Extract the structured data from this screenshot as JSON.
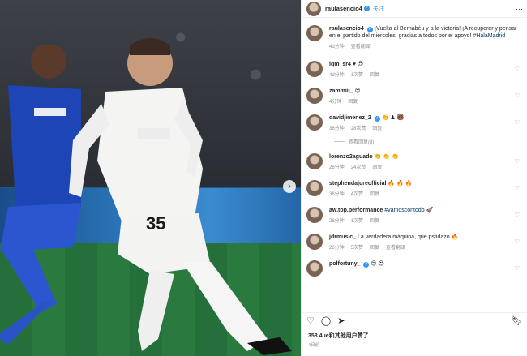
{
  "post_header": {
    "username": "raulasencio4",
    "follow_label": "关注",
    "more_icon": "more-horizontal-icon"
  },
  "caption": {
    "username": "raulasencio4",
    "text": "¡Vuelta al Bernabéu y a la victoria! ¡A recuperar y pensar en el partido del miércoles, gracias a todos por el apoyo!",
    "hashtag": "#HalaMadrid",
    "time": "4d分钟",
    "translate": "查看翻译"
  },
  "comments": [
    {
      "username": "iqm_sr4",
      "text": "♥ 😍",
      "time": "4d分钟",
      "likes": "1次赞",
      "reply": "回复"
    },
    {
      "username": "zammiii_",
      "text": "😍",
      "time": "4分钟",
      "likes": "",
      "reply": "回复"
    },
    {
      "username": "davidjimenez_2",
      "text": "👏 ♟ 🐻",
      "time": "36分钟",
      "likes": "28次赞",
      "reply": "回复"
    },
    {
      "username": "lorenzo2aguado",
      "text": "👏 👏 👏",
      "time": "26分钟",
      "likes": "24次赞",
      "reply": "回复"
    },
    {
      "username": "stephendajureofficial",
      "text": "🔥 🔥 🔥",
      "time": "36分钟",
      "likes": "4次赞",
      "reply": "回复"
    },
    {
      "username": "aw.top.performance",
      "text": "#vamoscontodo 🚀",
      "time": "26分钟",
      "likes": "1次赞",
      "reply": "回复"
    },
    {
      "username": "jdrmusic_",
      "text": "La verdadera máquina, que pstidazo 🔥",
      "time": "26分钟",
      "likes": "5次赞",
      "reply": "回复",
      "translate": "查看翻译"
    },
    {
      "username": "polfortuny_",
      "text": "😍 😍",
      "time": "",
      "likes": "",
      "reply": ""
    }
  ],
  "more_replies_label": "查看回复(8)",
  "actions": {
    "like_icon": "heart-icon",
    "comment_icon": "comment-icon",
    "share_icon": "send-icon",
    "save_icon": "bookmark-icon"
  },
  "likes_text": "358.4ue和其他用户赞了",
  "post_age": "4日前"
}
